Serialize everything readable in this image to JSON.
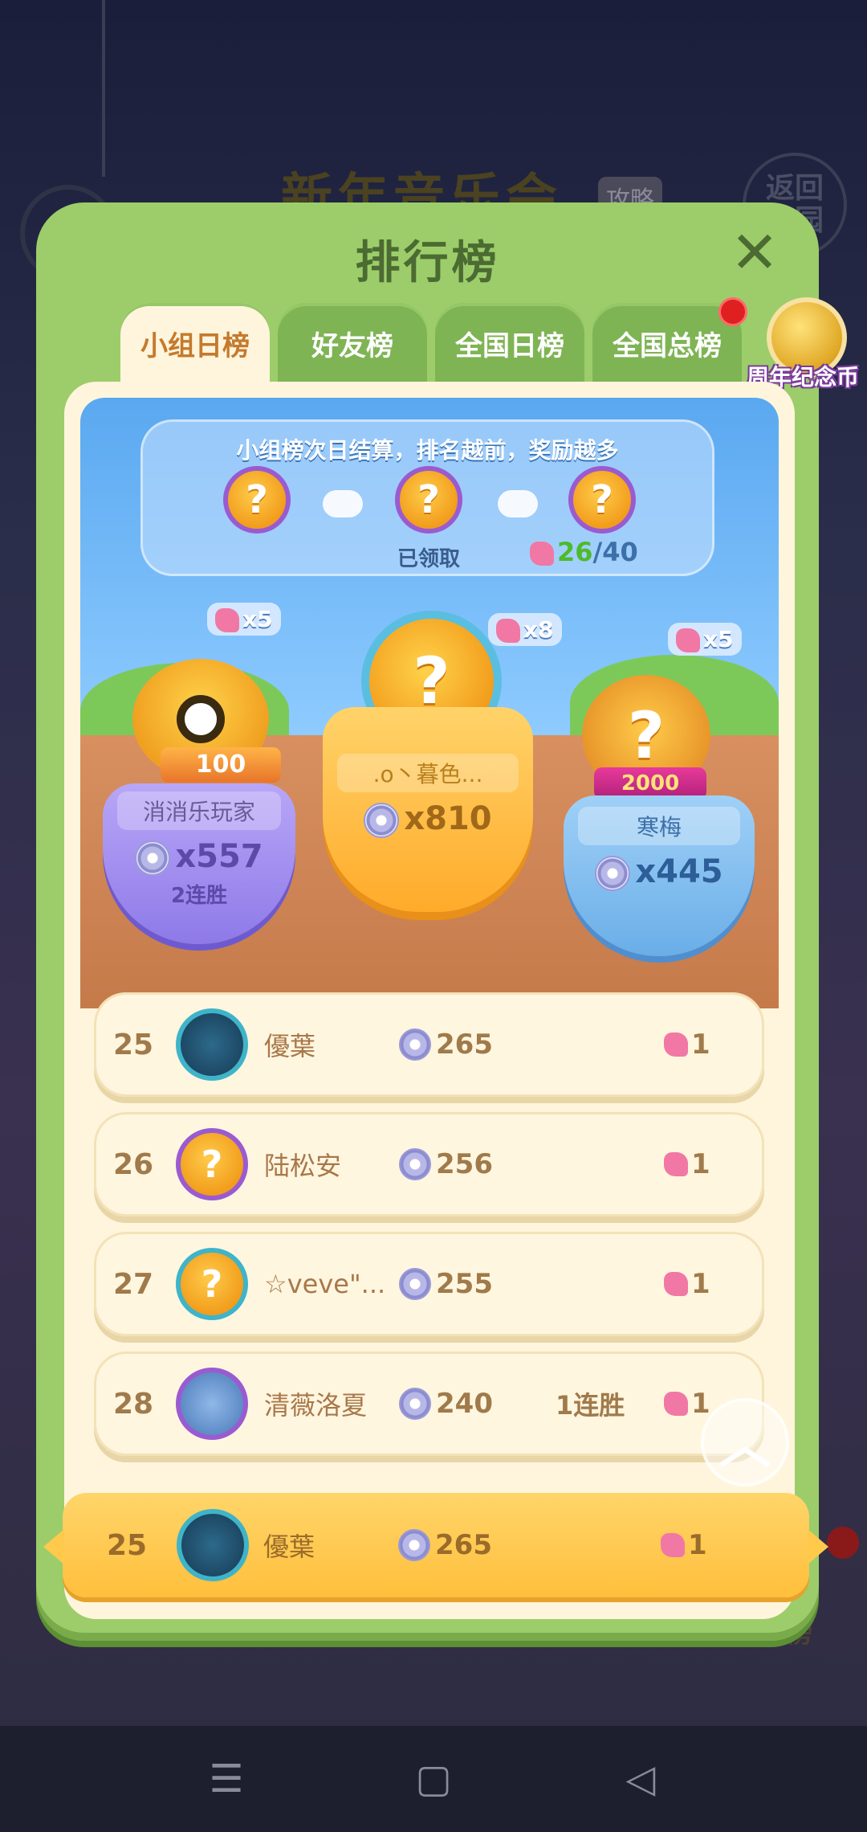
{
  "background": {
    "event_title": "新年音乐会",
    "guide_badge": "攻略",
    "return_button": "返回\n家园",
    "rank_label": "排行榜"
  },
  "panel": {
    "title": "排行榜",
    "close_icon": "close-icon"
  },
  "tabs": [
    {
      "label": "小组日榜",
      "active": true
    },
    {
      "label": "好友榜",
      "active": false
    },
    {
      "label": "全国日榜",
      "active": false
    },
    {
      "label": "全国总榜",
      "active": false
    }
  ],
  "anniversary_coin": {
    "label": "周年纪念币"
  },
  "info": {
    "title": "小组榜次日结算，排名越前，奖励越多",
    "claimed_label": "已领取",
    "progress_current": "26",
    "progress_total": "/40"
  },
  "podium": {
    "first": {
      "name": ".o丶暮色...",
      "score": "x810",
      "reward": "x8"
    },
    "second": {
      "name": "消消乐玩家",
      "score": "x557",
      "streak": "2连胜",
      "reward": "x5",
      "frame_label": "100"
    },
    "third": {
      "name": "寒梅",
      "score": "x445",
      "reward": "x5",
      "frame_label": "2000"
    }
  },
  "rows": [
    {
      "rank": "25",
      "name": "優葉",
      "score": "265",
      "streak": "",
      "reward": "1",
      "avatar": "teal"
    },
    {
      "rank": "26",
      "name": "陆松安",
      "score": "256",
      "streak": "",
      "reward": "1",
      "avatar": "question"
    },
    {
      "rank": "27",
      "name": "☆veve\"...",
      "score": "255",
      "streak": "",
      "reward": "1",
      "avatar": "question"
    },
    {
      "rank": "28",
      "name": "清薇洛夏",
      "score": "240",
      "streak": "1连胜",
      "reward": "1",
      "avatar": "question"
    }
  ],
  "my_row": {
    "rank": "25",
    "name": "優葉",
    "score": "265",
    "reward": "1"
  },
  "colors": {
    "panel_green": "#9ccd6a",
    "active_tab_text": "#c47a2e",
    "my_row_yellow": "#ffc94c",
    "progress_green": "#4dbb2a"
  }
}
